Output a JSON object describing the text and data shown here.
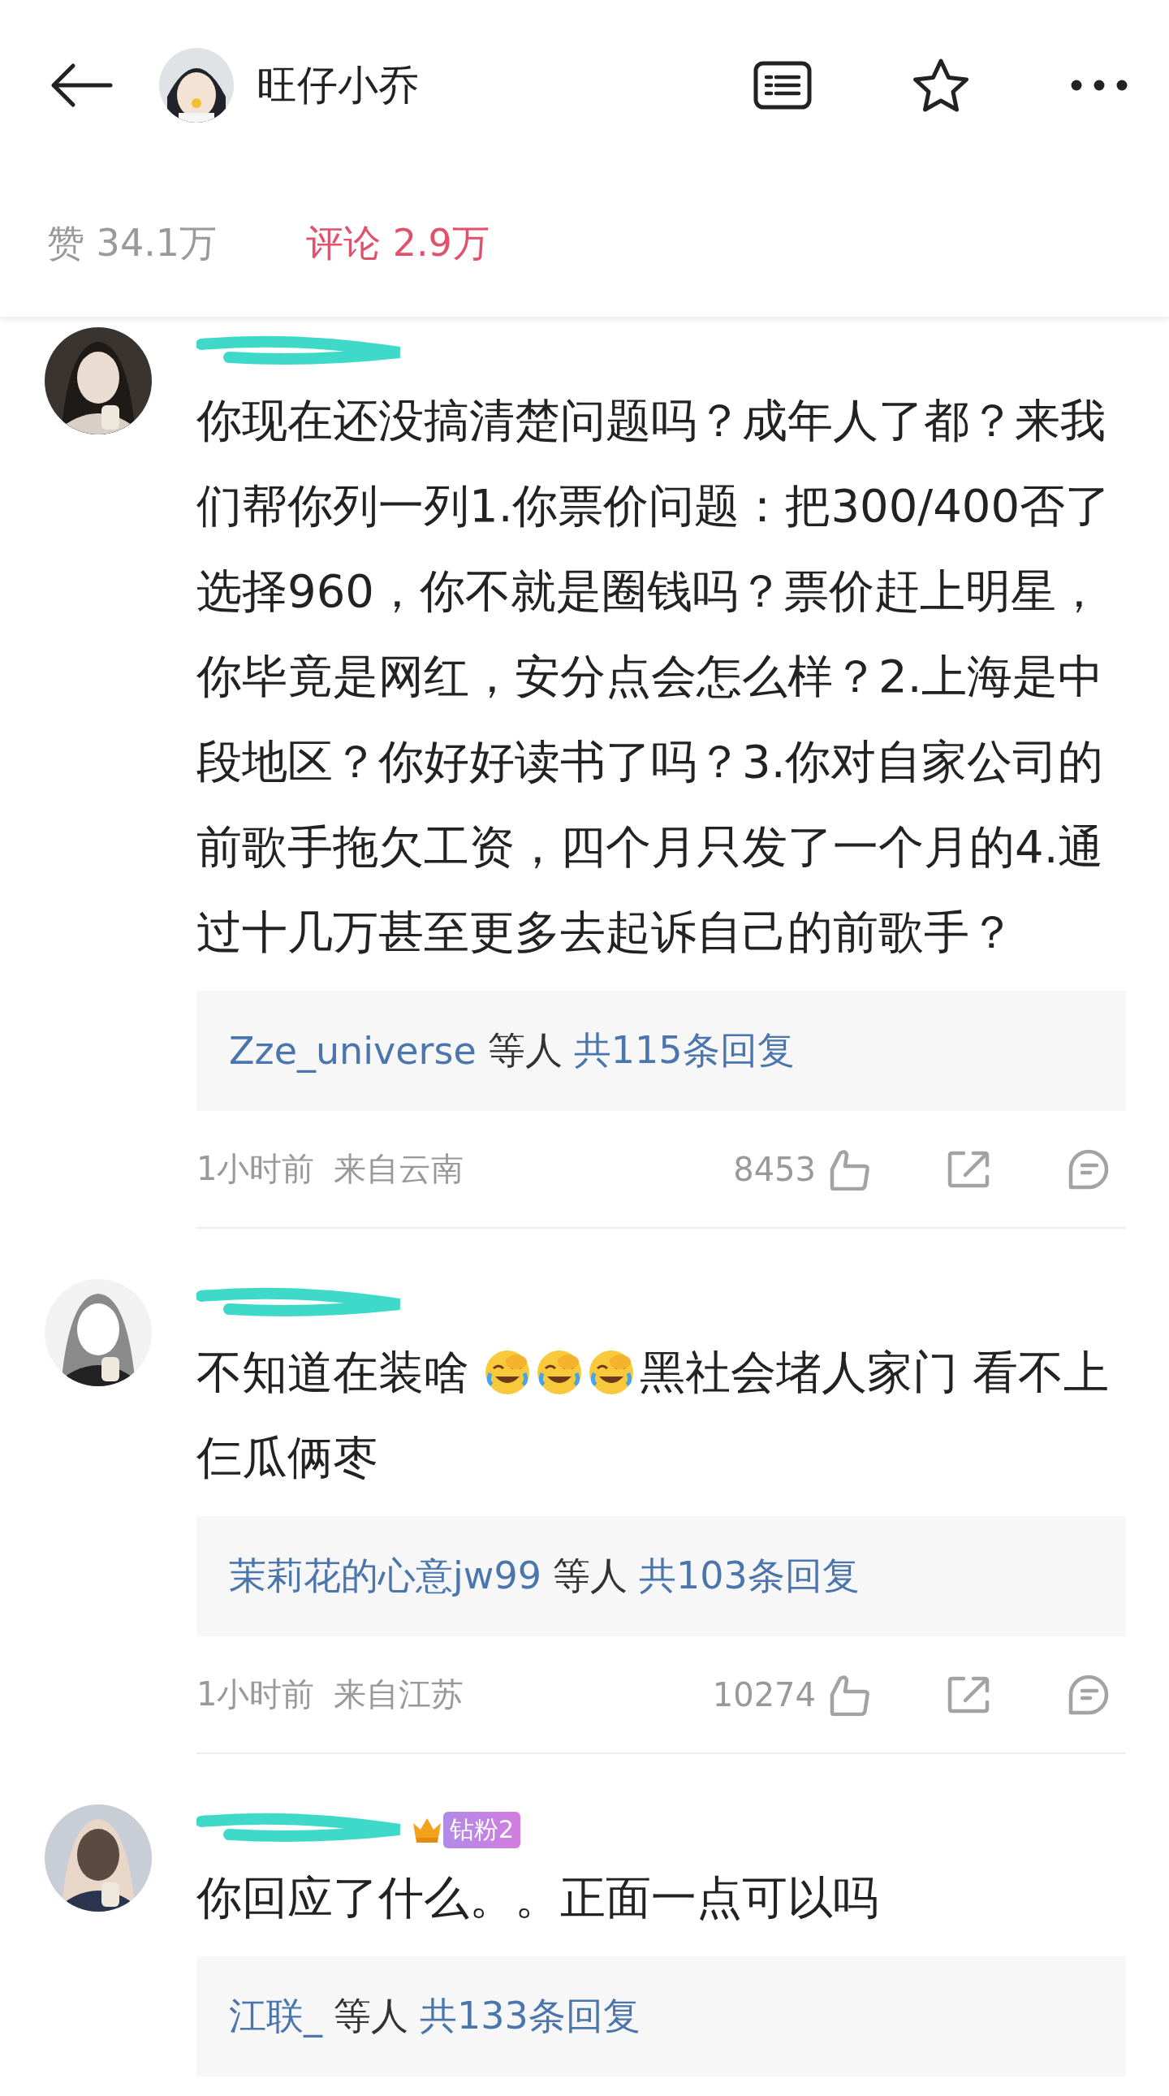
{
  "header": {
    "author": "旺仔小乔"
  },
  "stats": [
    {
      "label": "赞 34.1万",
      "selected": false
    },
    {
      "label": "评论 2.9万",
      "selected": true
    }
  ],
  "comments": [
    {
      "segments": [
        {
          "kind": "text",
          "text": "你现在还没搞清楚问题吗？成年人了都？来我们帮你列一列1.你票价问题：把300/400否了选择960，你不就是圈钱吗？票价赶上明星，你毕竟是网红，安分点会怎么样？2.上海是中段地区？你好好读书了吗？3.你对自家公司的前歌手拖欠工资，四个月只发了一个月的4.通过十几万甚至更多去起诉自己的前歌手？"
        }
      ],
      "replies": {
        "users": "Zze_universe",
        "joiner": "等人",
        "total": "共115条回复"
      },
      "meta": {
        "time": "1小时前",
        "location": "来自云南",
        "likes": "8453"
      }
    },
    {
      "segments": [
        {
          "kind": "text",
          "text": "不知道在装啥 "
        },
        {
          "kind": "emoji"
        },
        {
          "kind": "emoji"
        },
        {
          "kind": "emoji"
        },
        {
          "kind": "text",
          "text": "黑社会堵人家门 看不上"
        },
        {
          "kind": "break"
        },
        {
          "kind": "text",
          "text": "仨瓜俩枣"
        }
      ],
      "replies": {
        "users": "茉莉花的心意jw99",
        "joiner": "等人",
        "total": "共103条回复"
      },
      "meta": {
        "time": "1小时前",
        "location": "来自江苏",
        "likes": "10274"
      }
    },
    {
      "badge": "钻粉2",
      "segments": [
        {
          "kind": "text",
          "text": "你回应了什么。。正面一点可以吗"
        }
      ],
      "replies": {
        "users": "江联_",
        "joiner": "等人",
        "total": "共133条回复"
      }
    }
  ]
}
